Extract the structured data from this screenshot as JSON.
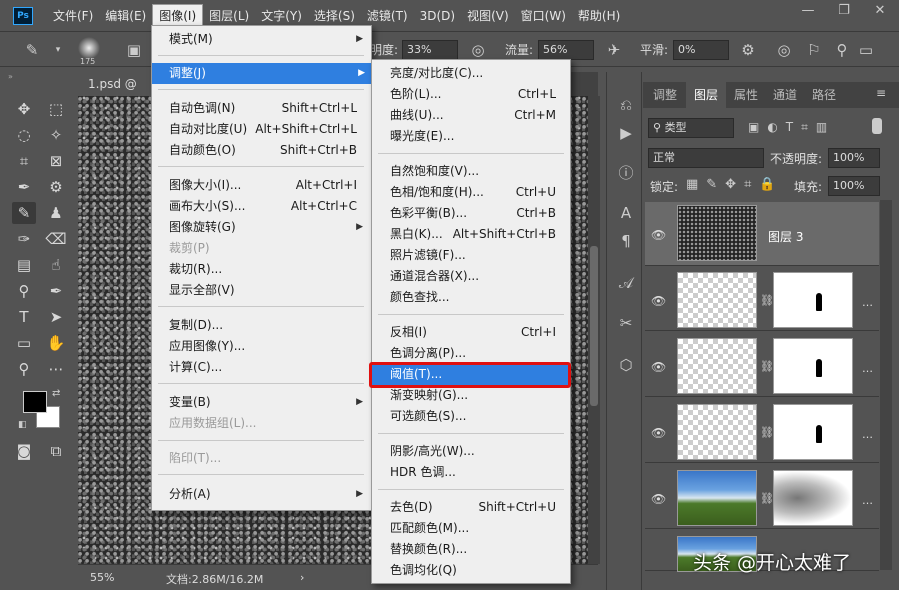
{
  "menubar": {
    "logo": "Ps",
    "items": [
      "文件(F)",
      "编辑(E)",
      "图像(I)",
      "图层(L)",
      "文字(Y)",
      "选择(S)",
      "滤镜(T)",
      "3D(D)",
      "视图(V)",
      "窗口(W)",
      "帮助(H)"
    ]
  },
  "options": {
    "brush_size": "175",
    "opacity_label": "明度:",
    "opacity_value": "33%",
    "flow_label": "流量:",
    "flow_value": "56%",
    "smooth_label": "平滑:",
    "smooth_value": "0%"
  },
  "document": {
    "tab_label": "1.psd @ 55",
    "zoom": "55%",
    "doc_info": "文档:2.86M/16.2M"
  },
  "image_menu": {
    "items": [
      {
        "label": "模式(M)",
        "shortcut": ""
      },
      {
        "label": "调整(J)",
        "shortcut": ""
      },
      {
        "label": "自动色调(N)",
        "shortcut": "Shift+Ctrl+L"
      },
      {
        "label": "自动对比度(U)",
        "shortcut": "Alt+Shift+Ctrl+L"
      },
      {
        "label": "自动颜色(O)",
        "shortcut": "Shift+Ctrl+B"
      },
      {
        "label": "图像大小(I)...",
        "shortcut": "Alt+Ctrl+I"
      },
      {
        "label": "画布大小(S)...",
        "shortcut": "Alt+Ctrl+C"
      },
      {
        "label": "图像旋转(G)",
        "shortcut": ""
      },
      {
        "label": "裁剪(P)",
        "shortcut": ""
      },
      {
        "label": "裁切(R)...",
        "shortcut": ""
      },
      {
        "label": "显示全部(V)",
        "shortcut": ""
      },
      {
        "label": "复制(D)...",
        "shortcut": ""
      },
      {
        "label": "应用图像(Y)...",
        "shortcut": ""
      },
      {
        "label": "计算(C)...",
        "shortcut": ""
      },
      {
        "label": "变量(B)",
        "shortcut": ""
      },
      {
        "label": "应用数据组(L)...",
        "shortcut": ""
      },
      {
        "label": "陷印(T)...",
        "shortcut": ""
      },
      {
        "label": "分析(A)",
        "shortcut": ""
      }
    ]
  },
  "adjust_menu": {
    "items": [
      {
        "label": "亮度/对比度(C)...",
        "shortcut": ""
      },
      {
        "label": "色阶(L)...",
        "shortcut": "Ctrl+L"
      },
      {
        "label": "曲线(U)...",
        "shortcut": "Ctrl+M"
      },
      {
        "label": "曝光度(E)...",
        "shortcut": ""
      },
      {
        "label": "自然饱和度(V)...",
        "shortcut": ""
      },
      {
        "label": "色相/饱和度(H)...",
        "shortcut": "Ctrl+U"
      },
      {
        "label": "色彩平衡(B)...",
        "shortcut": "Ctrl+B"
      },
      {
        "label": "黑白(K)...",
        "shortcut": "Alt+Shift+Ctrl+B"
      },
      {
        "label": "照片滤镜(F)...",
        "shortcut": ""
      },
      {
        "label": "通道混合器(X)...",
        "shortcut": ""
      },
      {
        "label": "颜色查找...",
        "shortcut": ""
      },
      {
        "label": "反相(I)",
        "shortcut": "Ctrl+I"
      },
      {
        "label": "色调分离(P)...",
        "shortcut": ""
      },
      {
        "label": "阈值(T)...",
        "shortcut": ""
      },
      {
        "label": "渐变映射(G)...",
        "shortcut": ""
      },
      {
        "label": "可选颜色(S)...",
        "shortcut": ""
      },
      {
        "label": "阴影/高光(W)...",
        "shortcut": ""
      },
      {
        "label": "HDR 色调...",
        "shortcut": ""
      },
      {
        "label": "去色(D)",
        "shortcut": "Shift+Ctrl+U"
      },
      {
        "label": "匹配颜色(M)...",
        "shortcut": ""
      },
      {
        "label": "替换颜色(R)...",
        "shortcut": ""
      },
      {
        "label": "色调均化(Q)",
        "shortcut": ""
      }
    ]
  },
  "layers_panel": {
    "tabs": [
      "调整",
      "图层",
      "属性",
      "通道",
      "路径"
    ],
    "kind_filter": "类型",
    "blend_mode": "正常",
    "opacity_label": "不透明度:",
    "opacity_value": "100%",
    "lock_label": "锁定:",
    "fill_label": "填充:",
    "fill_value": "100%",
    "layer_name": "图层 3"
  },
  "watermark": "头条 @开心太难了"
}
